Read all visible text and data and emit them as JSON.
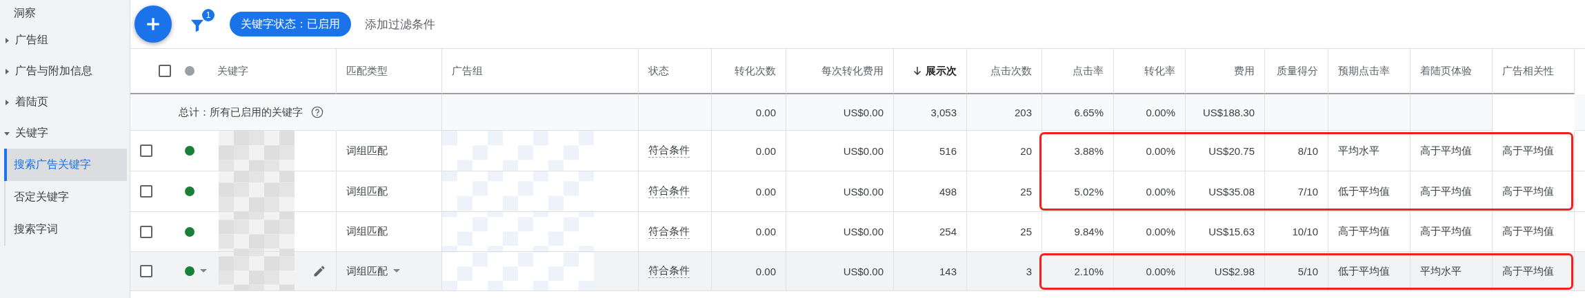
{
  "sidebar": {
    "items": [
      {
        "label": "洞察"
      },
      {
        "label": "广告组",
        "expanded": false
      },
      {
        "label": "广告与附加信息",
        "expanded": false
      },
      {
        "label": "着陆页",
        "expanded": false
      },
      {
        "label": "关键字",
        "expanded": true,
        "children": [
          {
            "label": "搜索广告关键字",
            "selected": true
          },
          {
            "label": "否定关键字",
            "selected": false
          },
          {
            "label": "搜索字词",
            "selected": false
          }
        ]
      }
    ]
  },
  "toolbar": {
    "filter_count": "1",
    "filter_chip": "关键字状态：已启用",
    "add_filter": "添加过滤条件"
  },
  "table": {
    "select_all_checked": false,
    "columns": [
      {
        "label": "关键字",
        "kind": "keyword",
        "sorted": false
      },
      {
        "label": "匹配类型",
        "kind": "match",
        "sorted": false
      },
      {
        "label": "广告组",
        "kind": "text",
        "sorted": false
      },
      {
        "label": "状态",
        "kind": "status",
        "sorted": false
      },
      {
        "label": "转化次数",
        "kind": "number",
        "sorted": false
      },
      {
        "label": "每次转化费用",
        "kind": "number",
        "sorted": false
      },
      {
        "label": "展示次",
        "kind": "number",
        "sorted": true
      },
      {
        "label": "点击次数",
        "kind": "number",
        "sorted": false
      },
      {
        "label": "点击率",
        "kind": "number",
        "sorted": false
      },
      {
        "label": "转化率",
        "kind": "number",
        "sorted": false
      },
      {
        "label": "费用",
        "kind": "number",
        "sorted": false
      },
      {
        "label": "质量得分",
        "kind": "number",
        "sorted": false
      },
      {
        "label": "预期点击率",
        "kind": "text",
        "sorted": false
      },
      {
        "label": "着陆页体验",
        "kind": "text",
        "sorted": false
      },
      {
        "label": "广告相关性",
        "kind": "text",
        "sorted": false
      }
    ],
    "total": {
      "label": "总计：所有已启用的关键字",
      "cells": [
        null,
        null,
        null,
        "0.00",
        "US$0.00",
        "3,053",
        "203",
        "6.65%",
        "0.00%",
        "US$188.30",
        null,
        null,
        null
      ]
    },
    "rows": [
      {
        "checked": false,
        "hovered": false,
        "highlighted": true,
        "cells": [
          null,
          "词组匹配",
          null,
          "符合条件",
          "0.00",
          "US$0.00",
          "516",
          "20",
          "3.88%",
          "0.00%",
          "US$20.75",
          "8/10",
          "平均水平",
          "高于平均值",
          "高于平均值"
        ]
      },
      {
        "checked": false,
        "hovered": false,
        "highlighted": true,
        "cells": [
          null,
          "词组匹配",
          null,
          "符合条件",
          "0.00",
          "US$0.00",
          "498",
          "25",
          "5.02%",
          "0.00%",
          "US$35.08",
          "7/10",
          "低于平均值",
          "高于平均值",
          "高于平均值"
        ]
      },
      {
        "checked": false,
        "hovered": false,
        "highlighted": false,
        "cells": [
          null,
          "词组匹配",
          null,
          "符合条件",
          "0.00",
          "US$0.00",
          "254",
          "25",
          "9.84%",
          "0.00%",
          "US$15.63",
          "10/10",
          "高于平均值",
          "高于平均值",
          "高于平均值"
        ]
      },
      {
        "checked": false,
        "hovered": true,
        "highlighted": true,
        "cells": [
          null,
          "词组匹配",
          null,
          "符合条件",
          "0.00",
          "US$0.00",
          "143",
          "3",
          "2.10%",
          "0.00%",
          "US$2.98",
          "5/10",
          "低于平均值",
          "平均水平",
          "高于平均值"
        ]
      }
    ]
  }
}
